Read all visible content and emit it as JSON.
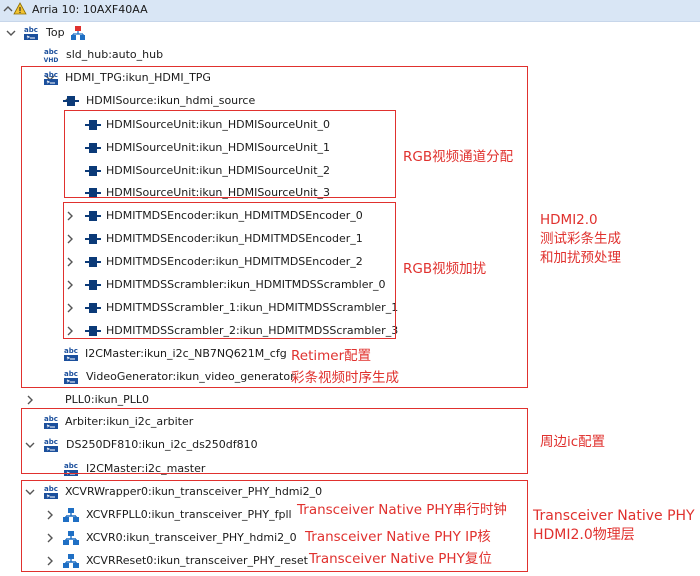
{
  "header": {
    "title": "Arria 10: 10AXF40AA"
  },
  "tree": [
    {
      "label": "Top",
      "icon": "abc-icon",
      "chevron": "down",
      "top_icon": true
    },
    {
      "label": "sld_hub:auto_hub",
      "icon": "abc-vhd-icon",
      "chevron": "none"
    },
    {
      "label": "HDMI_TPG:ikun_HDMI_TPG",
      "icon": "abc-icon",
      "chevron": "down"
    },
    {
      "label": "HDMISource:ikun_hdmi_source",
      "icon": "port-icon",
      "chevron": "down"
    },
    {
      "label": "HDMISourceUnit:ikun_HDMISourceUnit_0",
      "icon": "port-icon",
      "chevron": "none"
    },
    {
      "label": "HDMISourceUnit:ikun_HDMISourceUnit_1",
      "icon": "port-icon",
      "chevron": "none"
    },
    {
      "label": "HDMISourceUnit:ikun_HDMISourceUnit_2",
      "icon": "port-icon",
      "chevron": "none"
    },
    {
      "label": "HDMISourceUnit:ikun_HDMISourceUnit_3",
      "icon": "port-icon",
      "chevron": "none"
    },
    {
      "label": "HDMITMDSEncoder:ikun_HDMITMDSEncoder_0",
      "icon": "port-icon",
      "chevron": "right"
    },
    {
      "label": "HDMITMDSEncoder:ikun_HDMITMDSEncoder_1",
      "icon": "port-icon",
      "chevron": "right"
    },
    {
      "label": "HDMITMDSEncoder:ikun_HDMITMDSEncoder_2",
      "icon": "port-icon",
      "chevron": "right"
    },
    {
      "label": "HDMITMDSScrambler:ikun_HDMITMDSScrambler_0",
      "icon": "port-icon",
      "chevron": "right"
    },
    {
      "label": "HDMITMDSScrambler_1:ikun_HDMITMDSScrambler_1",
      "icon": "port-icon",
      "chevron": "right"
    },
    {
      "label": "HDMITMDSScrambler_2:ikun_HDMITMDSScrambler_3",
      "icon": "port-icon",
      "chevron": "right"
    },
    {
      "label": "I2CMaster:ikun_i2c_NB7NQ621M_cfg",
      "icon": "abc-icon",
      "chevron": "none"
    },
    {
      "label": "VideoGenerator:ikun_video_generator",
      "icon": "abc-icon",
      "chevron": "none"
    },
    {
      "label": "PLL0:ikun_PLL0",
      "icon": "none",
      "chevron": "right"
    },
    {
      "label": "Arbiter:ikun_i2c_arbiter",
      "icon": "abc-icon",
      "chevron": "none"
    },
    {
      "label": "DS250DF810:ikun_i2c_ds250df810",
      "icon": "abc-icon",
      "chevron": "down"
    },
    {
      "label": "I2CMaster:i2c_master",
      "icon": "abc-icon",
      "chevron": "none"
    },
    {
      "label": "XCVRWrapper0:ikun_transceiver_PHY_hdmi2_0",
      "icon": "abc-icon",
      "chevron": "down"
    },
    {
      "label": "XCVRFPLL0:ikun_transceiver_PHY_fpll",
      "icon": "hierarchy-icon",
      "chevron": "right"
    },
    {
      "label": "XCVR0:ikun_transceiver_PHY_hdmi2_0",
      "icon": "hierarchy-icon",
      "chevron": "right"
    },
    {
      "label": "XCVRReset0:ikun_transceiver_PHY_reset",
      "icon": "hierarchy-icon",
      "chevron": "right"
    }
  ],
  "annotations": {
    "rgb_channel": "RGB视频通道分配",
    "rgb_scramble": "RGB视频加扰",
    "hdmi_line1": "HDMI2.0",
    "hdmi_line2": "测试彩条生成",
    "hdmi_line3": "和加扰预处理",
    "retimer": "Retimer配置",
    "colorbar_timing": "彩条视频时序生成",
    "peripheral_ic": "周边ic配置",
    "phy_serial_clock": "Transceiver Native PHY串行时钟",
    "phy_ip_core": "Transceiver Native PHY IP核",
    "phy_reset": "Transceiver Native PHY复位",
    "phy_line1": "Transceiver Native PHY",
    "phy_line2": "HDMI2.0物理层"
  },
  "colors": {
    "annotation": "#e0312e",
    "selection": "#d9e6f5",
    "chevron": "#555555",
    "port_icon": "#0b3a78"
  }
}
